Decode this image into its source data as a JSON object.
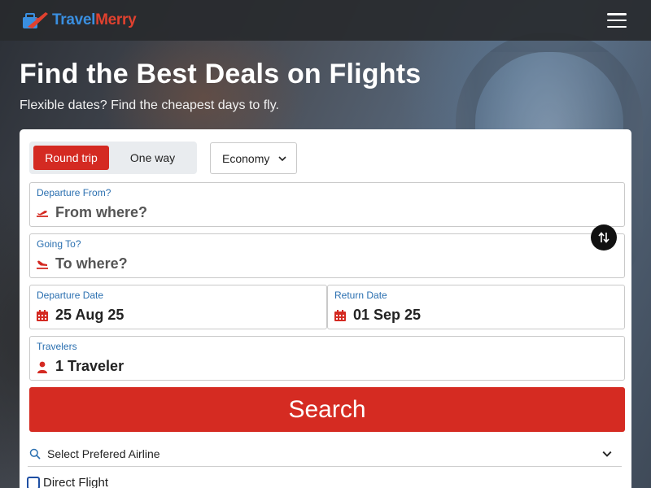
{
  "brand": {
    "name_part1": "Travel",
    "name_part2": "Merry"
  },
  "hero": {
    "title": "Find the Best Deals on Flights",
    "subtitle": "Flexible dates? Find the cheapest days to fly."
  },
  "search_form": {
    "trip_types": [
      {
        "label": "Round trip",
        "selected": true
      },
      {
        "label": "One way",
        "selected": false
      }
    ],
    "cabin_class": "Economy",
    "departure": {
      "label": "Departure From?",
      "placeholder": "From where?",
      "value": ""
    },
    "destination": {
      "label": "Going To?",
      "placeholder": "To where?",
      "value": ""
    },
    "departure_date": {
      "label": "Departure Date",
      "value": "25 Aug 25"
    },
    "return_date": {
      "label": "Return Date",
      "value": "01 Sep 25"
    },
    "travelers": {
      "label": "Travelers",
      "value": "1 Traveler"
    },
    "search_button": "Search",
    "airline_select": "Select Prefered Airline",
    "direct_flight": {
      "label": "Direct Flight",
      "checked": false
    }
  },
  "icons": {
    "menu": "hamburger-icon",
    "takeoff": "plane-takeoff-icon",
    "landing": "plane-landing-icon",
    "calendar": "calendar-icon",
    "person": "person-icon",
    "swap": "swap-icon",
    "search": "search-icon",
    "chevron": "chevron-down-icon"
  },
  "colors": {
    "accent_red": "#d42a22",
    "label_blue": "#2a6fb0",
    "logo_blue": "#3a8fe0",
    "logo_red": "#e0412f",
    "header_bg": "#28292e"
  }
}
